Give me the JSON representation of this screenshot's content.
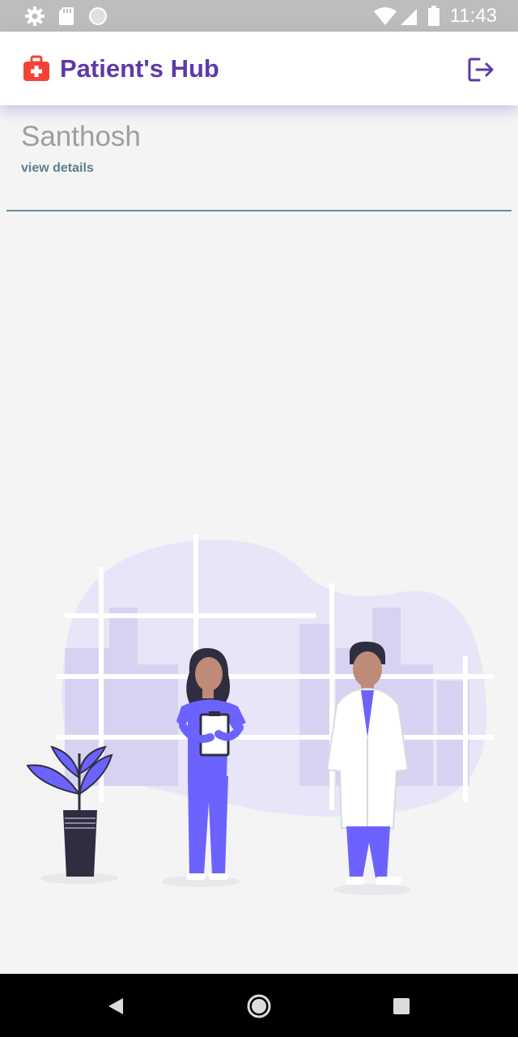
{
  "status_bar": {
    "time": "11:43",
    "icons": [
      "settings-icon",
      "sd-card-icon",
      "circle-icon",
      "wifi-icon",
      "signal-icon",
      "battery-icon"
    ]
  },
  "app_bar": {
    "title": "Patient's Hub",
    "logo_icon": "first-aid-kit-icon",
    "logout_icon": "logout-icon"
  },
  "patient": {
    "name": "Santhosh",
    "details_link": "view details"
  },
  "illustration": {
    "icon": "doctors-illustration",
    "accent": "#6c63ff"
  },
  "nav_bar": {
    "icons": [
      "back-icon",
      "home-icon",
      "recents-icon"
    ]
  },
  "colors": {
    "brand": "#5e3aa8",
    "logo": "#f44336",
    "link": "#5f7d8c",
    "background": "#f4f4f4"
  }
}
